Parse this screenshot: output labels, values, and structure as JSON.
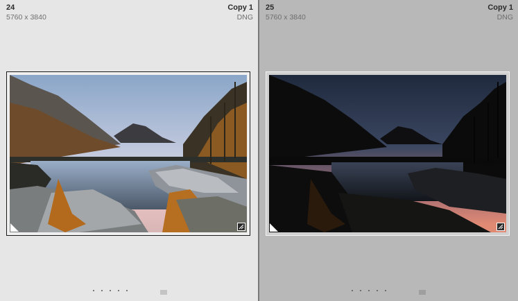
{
  "thumbnails": [
    {
      "index": "24",
      "dimensions": "5760 x 3840",
      "copy_label": "Copy 1",
      "file_type": "DNG",
      "state": "selected",
      "photo_variant": "bright"
    },
    {
      "index": "25",
      "dimensions": "5760 x 3840",
      "copy_label": "Copy 1",
      "file_type": "DNG",
      "state": "unselected",
      "photo_variant": "dark"
    }
  ],
  "colors": {
    "selected_cell_bg": "#e6e6e6",
    "unselected_cell_bg": "#b8b8b8",
    "divider": "#7a7a7a"
  }
}
